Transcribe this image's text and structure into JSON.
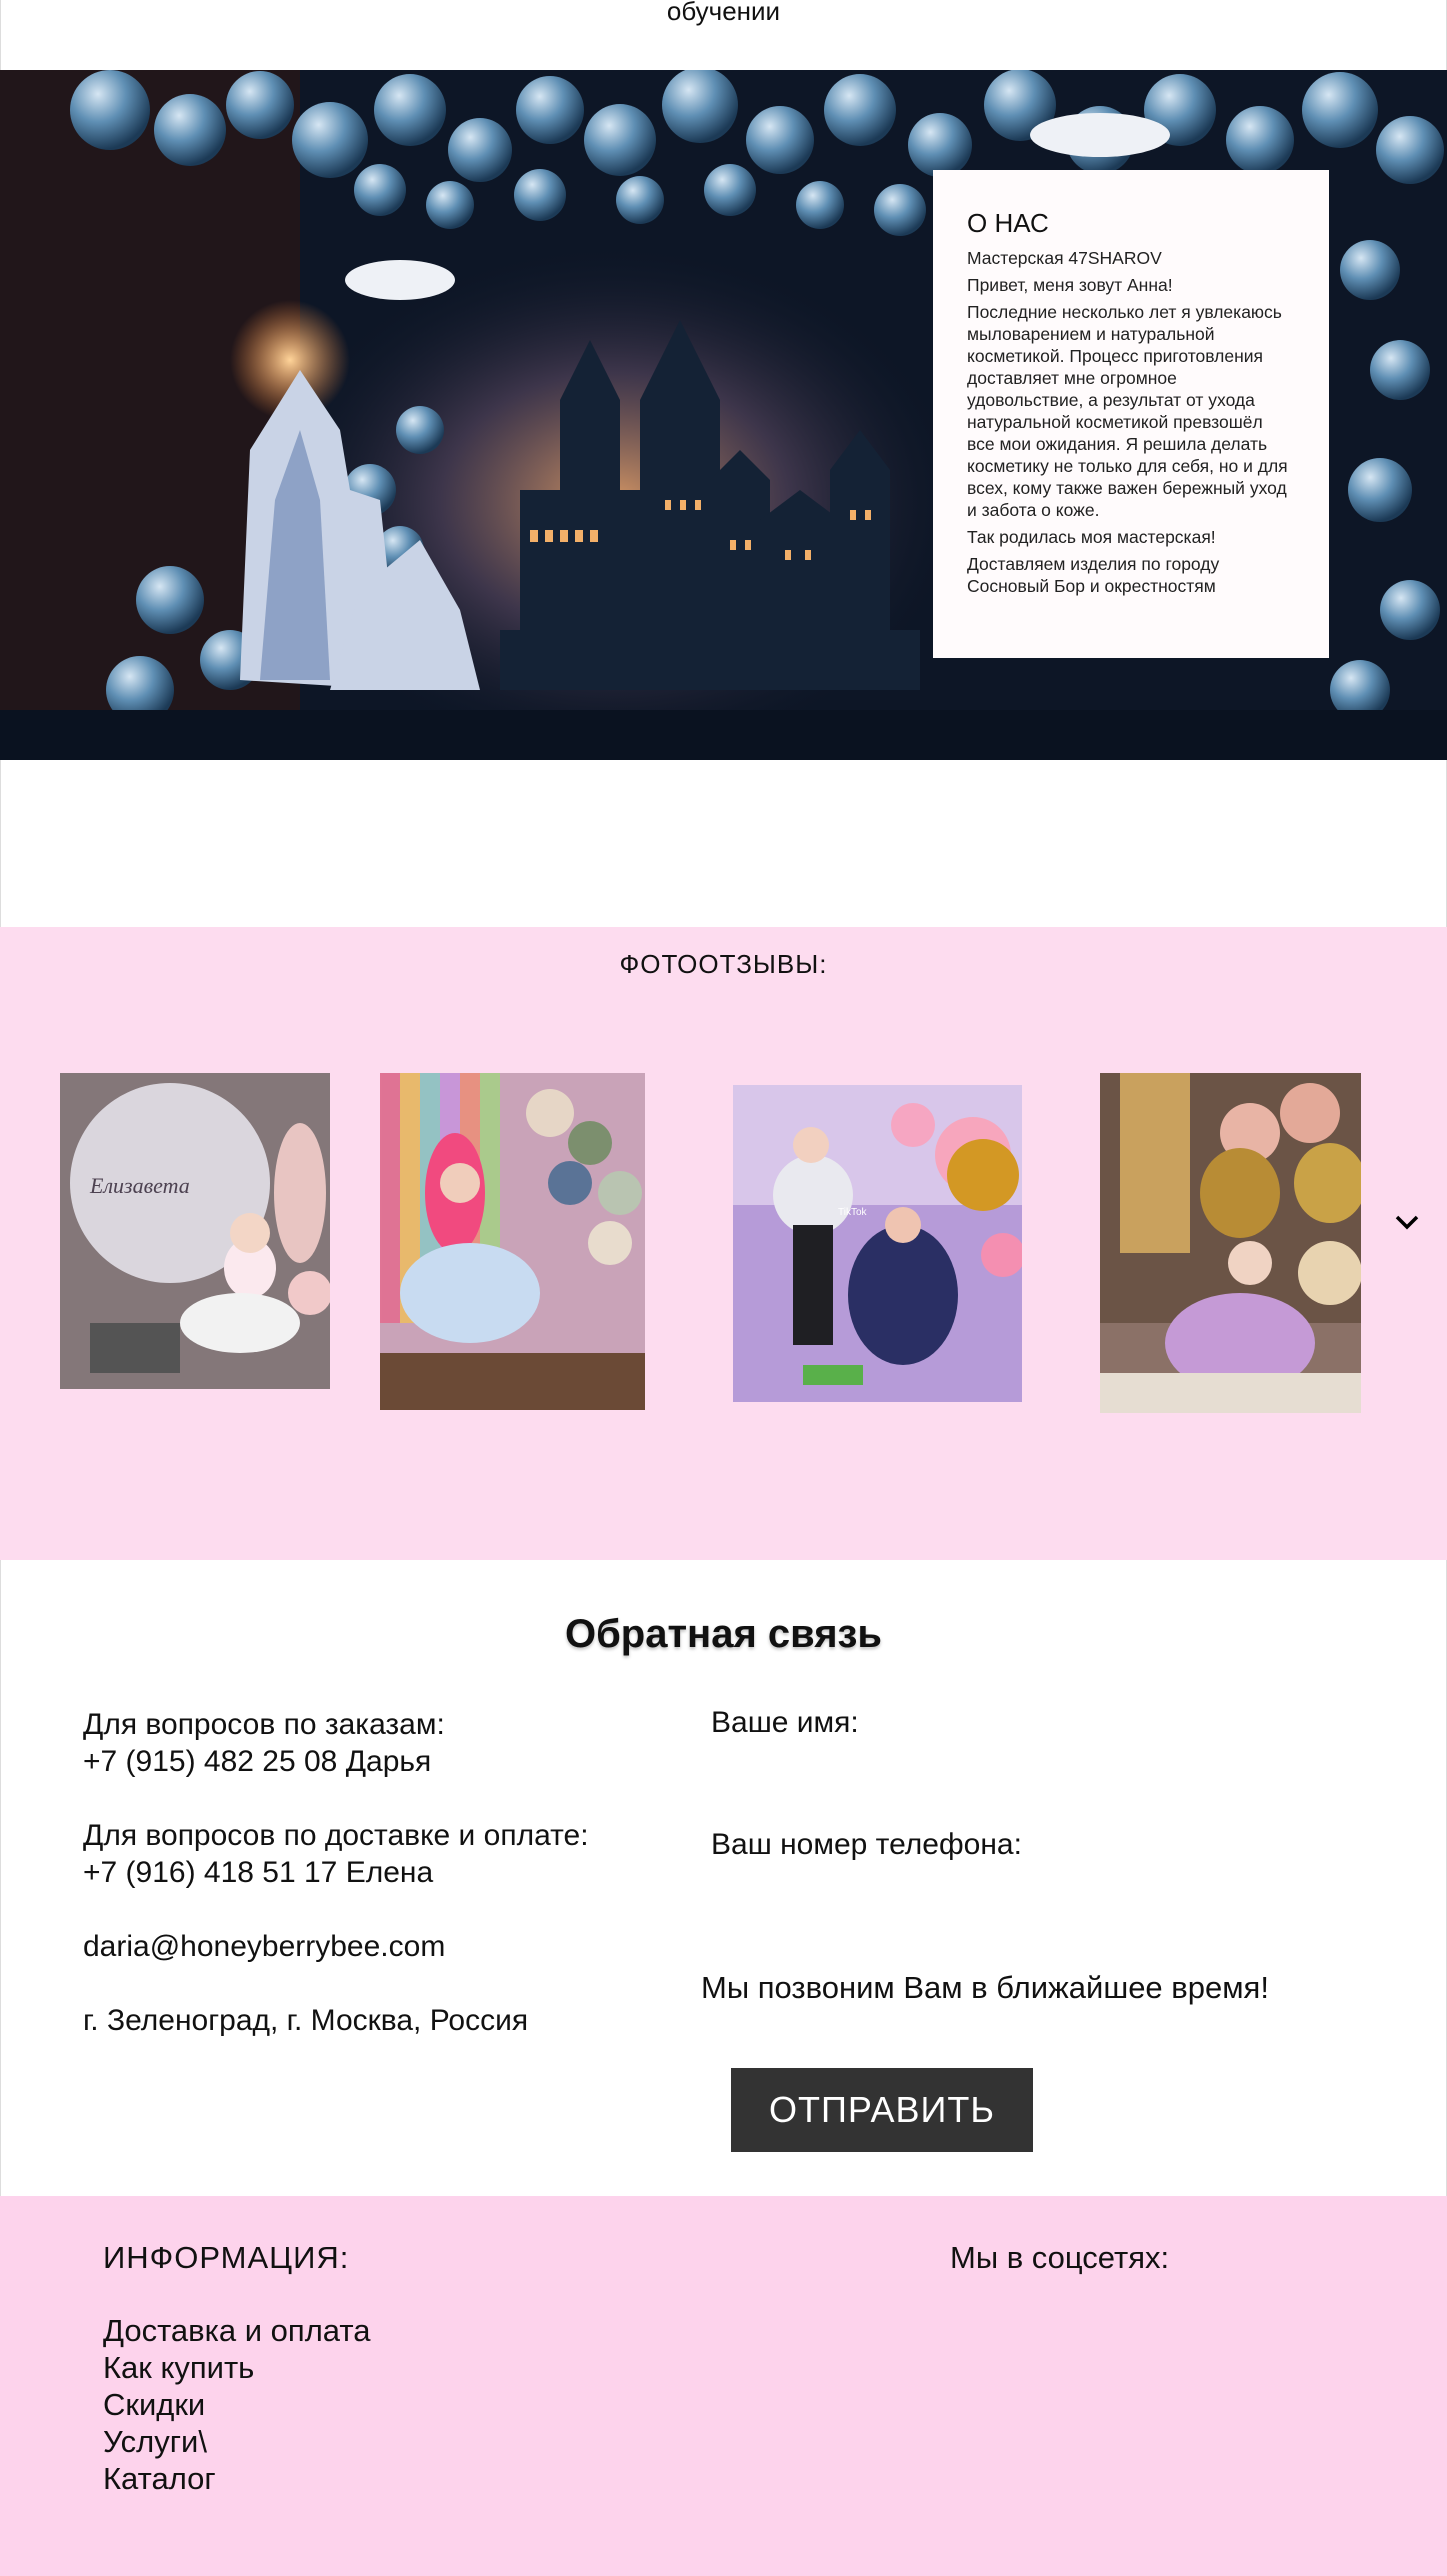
{
  "top": {
    "text": "обучении"
  },
  "about": {
    "title": "О НАС",
    "paragraphs": [
      "Мастерская 47SHAROV",
      "Привет, меня зовут Анна!",
      "Последние несколько лет я увлекаюсь мыловарением и натуральной косметикой. Процесс приготовления доставляет мне огромное удовольствие, а результат от ухода натуральной косметикой превзошёл все мои ожидания. Я решила делать косметику не только для себя, но и для всех, кому также важен бережный уход и забота о коже.",
      "Так родилась моя мастерская!",
      "Доставляем изделия по городу Сосновый Бор и окрестностям"
    ]
  },
  "reviews": {
    "title": "ФОТООТЗЫВЫ:",
    "photos": [
      {
        "caption": "Елизавета"
      },
      {
        "caption": ""
      },
      {
        "caption": "TikTok"
      },
      {
        "caption": ""
      }
    ]
  },
  "feedback": {
    "title": "Обратная связь",
    "contacts": {
      "orders_label": "Для вопросов по заказам:",
      "orders_phone": "+7 (915) 482 25 08 Дарья",
      "delivery_label": "Для вопросов по доставке и оплате:",
      "delivery_phone": "+7 (916) 418 51 17 Елена",
      "email": "daria@honeyberrybee.com",
      "address": "г. Зеленоград, г. Москва, Россия"
    },
    "form": {
      "name_label": "Ваше имя:",
      "phone_label": "Ваш номер телефона:",
      "note": "Мы позвоним Вам в ближайшее время!",
      "submit": "ОТПРАВИТЬ"
    }
  },
  "footer": {
    "info_title": "ИНФОРМАЦИЯ:",
    "links": [
      "Доставка и оплата",
      "Как купить",
      "Скидки",
      "Услуги\\",
      "Каталог"
    ],
    "social_title": "Мы в соцсетях:"
  },
  "colors": {
    "pink_section": "#fddcef",
    "pink_footer": "#fdd3ec",
    "button": "#333333"
  },
  "icons": {
    "next": "chevron-down-icon"
  }
}
